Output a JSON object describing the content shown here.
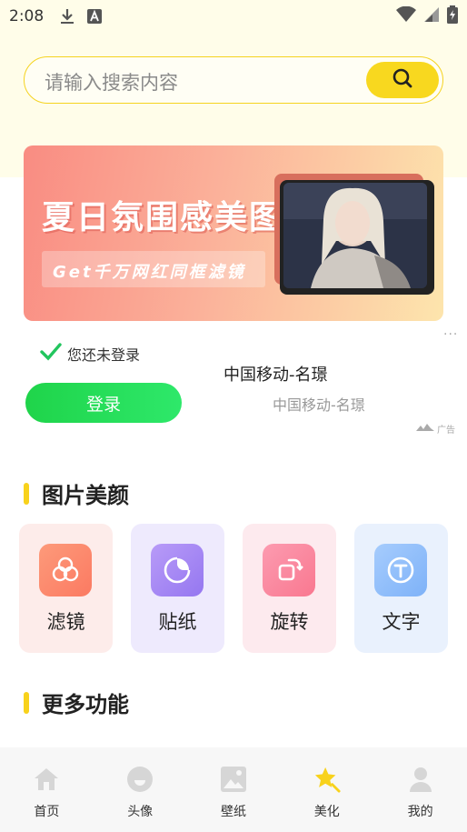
{
  "status_bar": {
    "time": "2:08",
    "icons": [
      "download-icon",
      "font-a-icon",
      "wifi-icon",
      "signal-icon",
      "battery-charging-icon"
    ]
  },
  "search": {
    "placeholder": "请输入搜索内容",
    "icon": "search-icon"
  },
  "banner": {
    "title": "夏日氛围感美图",
    "subtitle": "Get千万网红同框滤镜"
  },
  "login": {
    "status_text": "您还未登录",
    "button_label": "登录"
  },
  "ad": {
    "title": "中国移动-名璟",
    "subtitle": "中国移动-名璟",
    "more": "···",
    "tag": "广告"
  },
  "sections": {
    "beauty_title": "图片美颜",
    "more_title": "更多功能"
  },
  "features": [
    {
      "label": "滤镜",
      "icon": "filter-icon",
      "bg": "#fdecea",
      "icon_bg": "#fd8a6e"
    },
    {
      "label": "贴纸",
      "icon": "sticker-icon",
      "bg": "#eeeafd",
      "icon_bg": "#a98bf5"
    },
    {
      "label": "旋转",
      "icon": "rotate-icon",
      "bg": "#fdeaee",
      "icon_bg": "#fb8aa0"
    },
    {
      "label": "文字",
      "icon": "text-icon",
      "bg": "#e9f1fd",
      "icon_bg": "#8ec0fb"
    }
  ],
  "nav": [
    {
      "label": "首页",
      "icon": "home-icon",
      "active": false
    },
    {
      "label": "头像",
      "icon": "avatar-icon",
      "active": false
    },
    {
      "label": "壁纸",
      "icon": "wallpaper-icon",
      "active": false
    },
    {
      "label": "美化",
      "icon": "beautify-star-icon",
      "active": true
    },
    {
      "label": "我的",
      "icon": "profile-icon",
      "active": false
    }
  ],
  "colors": {
    "accent_yellow": "#f8d81f",
    "login_green": "#22d84f",
    "top_background": "#fffde9"
  }
}
